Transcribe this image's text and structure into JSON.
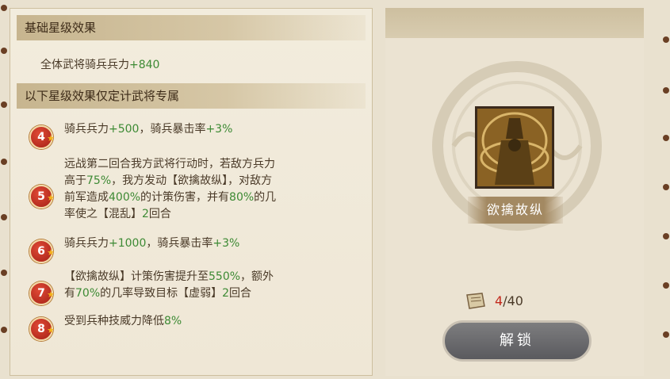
{
  "base_section": {
    "title": "基础星级效果",
    "effect_prefix": "全体武将骑兵兵力",
    "effect_value": "+840"
  },
  "exclusive_section": {
    "title": "以下星级效果仅定计武将专属"
  },
  "star_effects": [
    {
      "stars": "4",
      "lines": [
        [
          "骑兵兵力",
          "+500",
          "，骑兵暴击率",
          "+3%"
        ]
      ]
    },
    {
      "stars": "5",
      "lines": [
        [
          "远战第二回合我方武将行动时，若敌方兵力"
        ],
        [
          "高于",
          "75%",
          "，我方发动【欲擒故纵】，对敌方"
        ],
        [
          "前军造成",
          "400%",
          "的计策伤害，并有",
          "80%",
          "的几"
        ],
        [
          "率使之【混乱】",
          "2",
          "回合"
        ]
      ]
    },
    {
      "stars": "6",
      "lines": [
        [
          "骑兵兵力",
          "+1000",
          "，骑兵暴击率",
          "+3%"
        ]
      ]
    },
    {
      "stars": "7",
      "lines": [
        [
          "【欲擒故纵】计策伤害提升至",
          "550%",
          "，额外"
        ],
        [
          "有",
          "70%",
          "的几率导致目标【虚弱】",
          "2",
          "回合"
        ]
      ]
    },
    {
      "stars": "8",
      "lines": [
        [
          "受到兵种技威力降低",
          "8%"
        ]
      ]
    }
  ],
  "strategy_card": {
    "name": "欲擒故纵",
    "icon": "general-portrait-icon"
  },
  "fragments": {
    "current": "4",
    "separator": "/",
    "total": "40",
    "icon": "scroll-icon"
  },
  "unlock_button": {
    "label": "解锁"
  },
  "colors": {
    "highlight_green": "#3d8a34",
    "badge_red": "#c0301e",
    "count_red": "#c2281b"
  }
}
